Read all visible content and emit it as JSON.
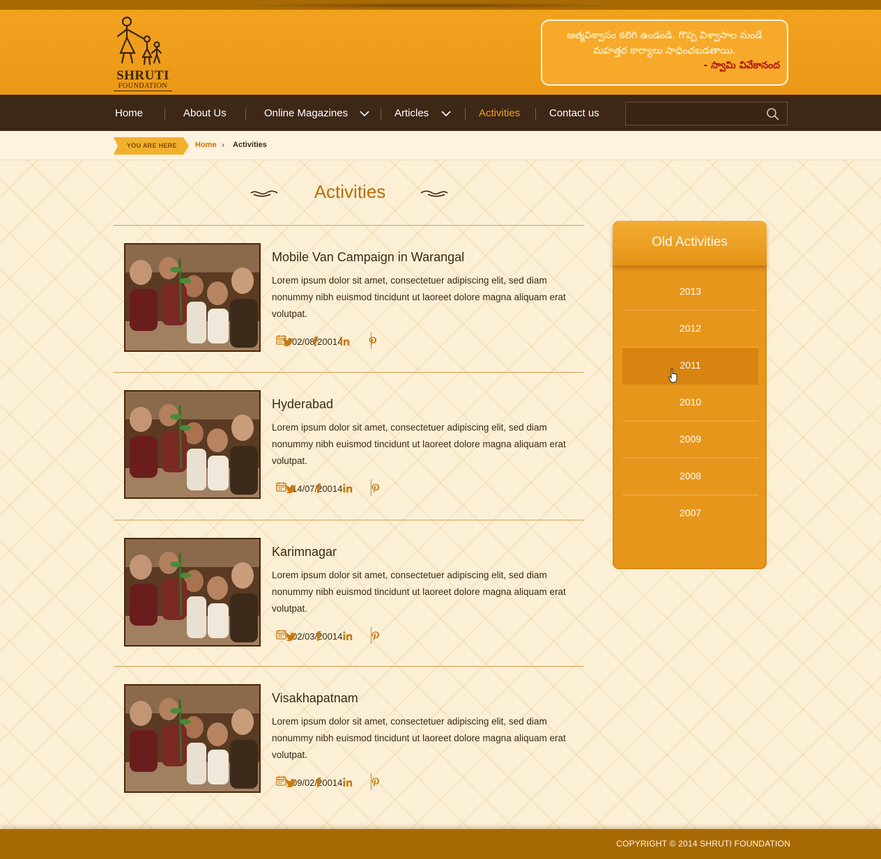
{
  "brand": {
    "name": "SHRUTI",
    "subtitle": "FOUNDATION"
  },
  "quote": {
    "line1": "ఆత్మవిశ్వాసం కలిగి ఉండండి. గొప్ప విశ్వాసాల నుండే",
    "line2": "మహత్తర కార్యాలు సాధించబడతాయి.",
    "author": "- స్వామి వివేకానంద"
  },
  "nav": {
    "items": [
      {
        "label": "Home"
      },
      {
        "label": "About Us"
      },
      {
        "label": "Online Magazines"
      },
      {
        "label": "Articles"
      },
      {
        "label": "Activities"
      },
      {
        "label": "Contact us"
      }
    ],
    "active": "Activities",
    "search_value": ""
  },
  "breadcrumb": {
    "badge": "YOU ARE HERE",
    "home": "Home",
    "current": "Activities"
  },
  "page": {
    "title": "Activities"
  },
  "activities": [
    {
      "title": "Mobile Van Campaign in Warangal",
      "description": "Lorem ipsum dolor sit amet, consectetuer adipiscing elit, sed diam nonummy nibh euismod tincidunt ut laoreet dolore magna aliquam erat volutpat.",
      "date": "02/08/20014"
    },
    {
      "title": "Hyderabad",
      "description": "Lorem ipsum dolor sit amet, consectetuer adipiscing elit, sed diam nonummy nibh euismod tincidunt ut laoreet dolore magna aliquam erat volutpat.",
      "date": "14/07/20014"
    },
    {
      "title": "Karimnagar",
      "description": "Lorem ipsum dolor sit amet, consectetuer adipiscing elit, sed diam nonummy nibh euismod tincidunt ut laoreet dolore magna aliquam erat volutpat.",
      "date": "02/03/20014"
    },
    {
      "title": "Visakhapatnam",
      "description": "Lorem ipsum dolor sit amet, consectetuer adipiscing elit, sed diam nonummy nibh euismod tincidunt ut laoreet dolore magna aliquam erat volutpat.",
      "date": "09/02/20014"
    }
  ],
  "social_icons": [
    "twitter-icon",
    "facebook-icon",
    "linkedin-icon",
    "pinterest-icon"
  ],
  "sidebar": {
    "title": "Old Activities",
    "years": [
      "2013",
      "2012",
      "2011",
      "2010",
      "2009",
      "2008",
      "2007"
    ],
    "hovered": "2011"
  },
  "footer": {
    "copyright": "COPYRIGHT © 2014 SHRUTI FOUNDATION"
  },
  "colors": {
    "brand_orange": "#eb9817",
    "nav_brown": "#3d2717",
    "accent": "#f0a11d",
    "footer": "#a86a05"
  }
}
